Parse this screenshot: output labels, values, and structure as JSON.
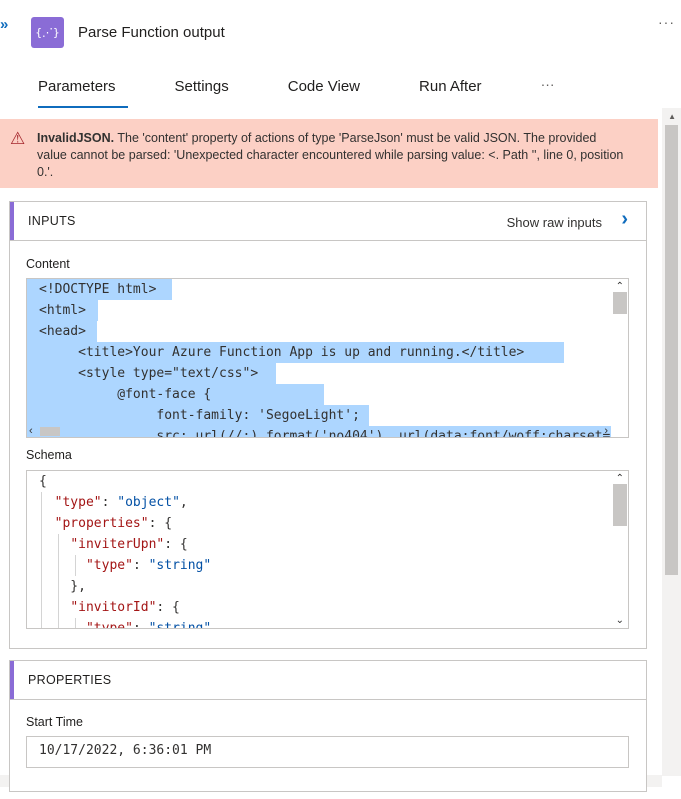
{
  "action": {
    "title": "Parse Function output",
    "icon": "braces-icon",
    "icon_glyph": "{⋰}",
    "collapse_glyph": "»",
    "more_glyph": "···"
  },
  "tabs": [
    {
      "label": "Parameters",
      "active": true
    },
    {
      "label": "Settings"
    },
    {
      "label": "Code View"
    },
    {
      "label": "Run After"
    }
  ],
  "tabs_more": "···",
  "error": {
    "title": "InvalidJSON.",
    "message": " The 'content' property of actions of type 'ParseJson' must be valid JSON. The provided value cannot be parsed: 'Unexpected character encountered while parsing value: <. Path '', line 0, position 0.'."
  },
  "inputs": {
    "header": "INPUTS",
    "show_raw": "Show raw inputs",
    "content_label": "Content",
    "content_lines": [
      "<!DOCTYPE html>",
      "<html>",
      "<head>",
      "     <title>Your Azure Function App is up and running.</title>",
      "     <style type=\"text/css\">",
      "          @font-face {",
      "               font-family: 'SegoeLight';",
      "               src: url(//:) format('no404'), url(data:font/woff;charset="
    ],
    "schema_label": "Schema",
    "schema_lines": [
      [
        {
          "t": "{",
          "c": ""
        }
      ],
      [
        {
          "t": "  ",
          "c": ""
        },
        {
          "t": "\"type\"",
          "c": "json-key"
        },
        {
          "t": ": ",
          "c": ""
        },
        {
          "t": "\"object\"",
          "c": "json-str"
        },
        {
          "t": ",",
          "c": ""
        }
      ],
      [
        {
          "t": "  ",
          "c": ""
        },
        {
          "t": "\"properties\"",
          "c": "json-key"
        },
        {
          "t": ": {",
          "c": ""
        }
      ],
      [
        {
          "t": "    ",
          "c": ""
        },
        {
          "t": "\"inviterUpn\"",
          "c": "json-key"
        },
        {
          "t": ": {",
          "c": ""
        }
      ],
      [
        {
          "t": "      ",
          "c": ""
        },
        {
          "t": "\"type\"",
          "c": "json-key"
        },
        {
          "t": ": ",
          "c": ""
        },
        {
          "t": "\"string\"",
          "c": "json-str"
        }
      ],
      [
        {
          "t": "    },",
          "c": ""
        }
      ],
      [
        {
          "t": "    ",
          "c": ""
        },
        {
          "t": "\"invitorId\"",
          "c": "json-key"
        },
        {
          "t": ": {",
          "c": ""
        }
      ],
      [
        {
          "t": "      ",
          "c": ""
        },
        {
          "t": "\"type\"",
          "c": "json-key"
        },
        {
          "t": ": ",
          "c": ""
        },
        {
          "t": "\"string\"",
          "c": "json-str"
        }
      ]
    ]
  },
  "properties": {
    "header": "PROPERTIES",
    "start_label": "Start Time",
    "start_value": "10/17/2022, 6:36:01 PM"
  },
  "colors": {
    "accent": "#8a6cd6",
    "link": "#0f6cbd",
    "error_bg": "#fcd0c5",
    "selection": "#add6ff"
  }
}
